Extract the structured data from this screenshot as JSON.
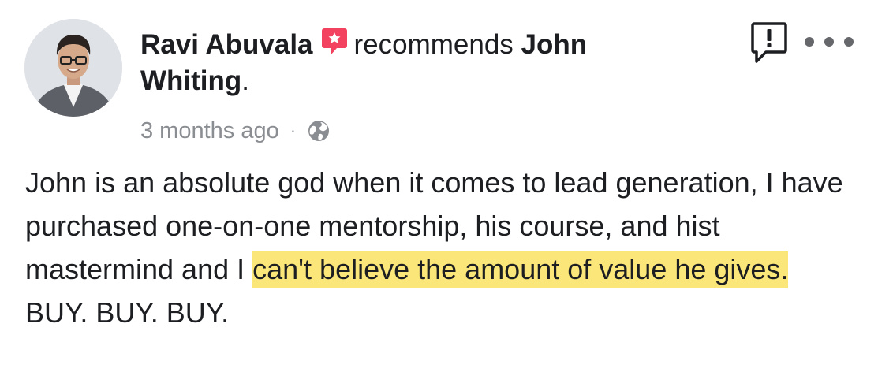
{
  "post": {
    "author": "Ravi Abuvala",
    "action": "recommends",
    "subject_first": "John",
    "subject_last": "Whiting",
    "subject_end": ".",
    "timestamp": "3 months ago",
    "separator": "·",
    "audience_icon": "globe-icon",
    "text_plain": "John is an absolute god when it comes to lead generation, I have purchased one-on-one mentorship, his course, and hist mastermind and I ",
    "text_highlight": "can't believe the amount of value he gives.",
    "text_after": " BUY. BUY. BUY."
  },
  "colors": {
    "highlight": "#fbe679",
    "recommend_badge": "#f3425f",
    "meta_text": "#8a8d91",
    "icon_gray": "#65676b"
  },
  "icons": {
    "recommend": "recommend-badge-icon",
    "report": "report-flag-icon",
    "more": "more-dots-icon"
  }
}
